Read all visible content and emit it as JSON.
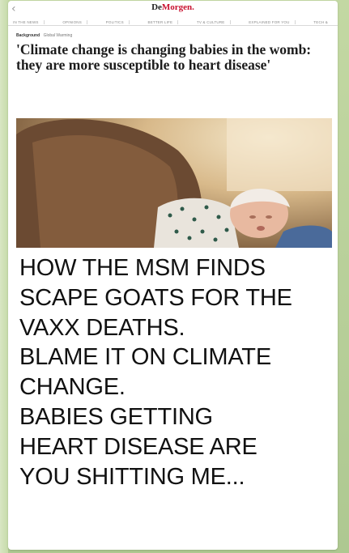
{
  "site": {
    "logo_part1": "De",
    "logo_part2": "Morgen.",
    "nav": [
      "IN THE NEWS",
      "OPINIONS",
      "POLITICS",
      "BETTER LIFE",
      "TV & CULTURE",
      "EXPLAINED FOR YOU",
      "TECH &"
    ]
  },
  "article": {
    "category": "Background",
    "tag": "Global Warming",
    "headline": "'Climate change is changing babies in the womb: they are more susceptible to heart disease'"
  },
  "message": {
    "caption": "HOW THE MSM FINDS\nSCAPE GOATS FOR THE\nVAXX DEATHS.\nBLAME IT ON CLIMATE\nCHANGE.\nBABIES GETTING\nHEART DISEASE ARE\nYOU SHITTING ME..."
  },
  "colors": {
    "chat_background": "#b7cf9a",
    "logo_accent": "#c8102e"
  },
  "icons": {
    "back": "chevron-left-icon"
  }
}
